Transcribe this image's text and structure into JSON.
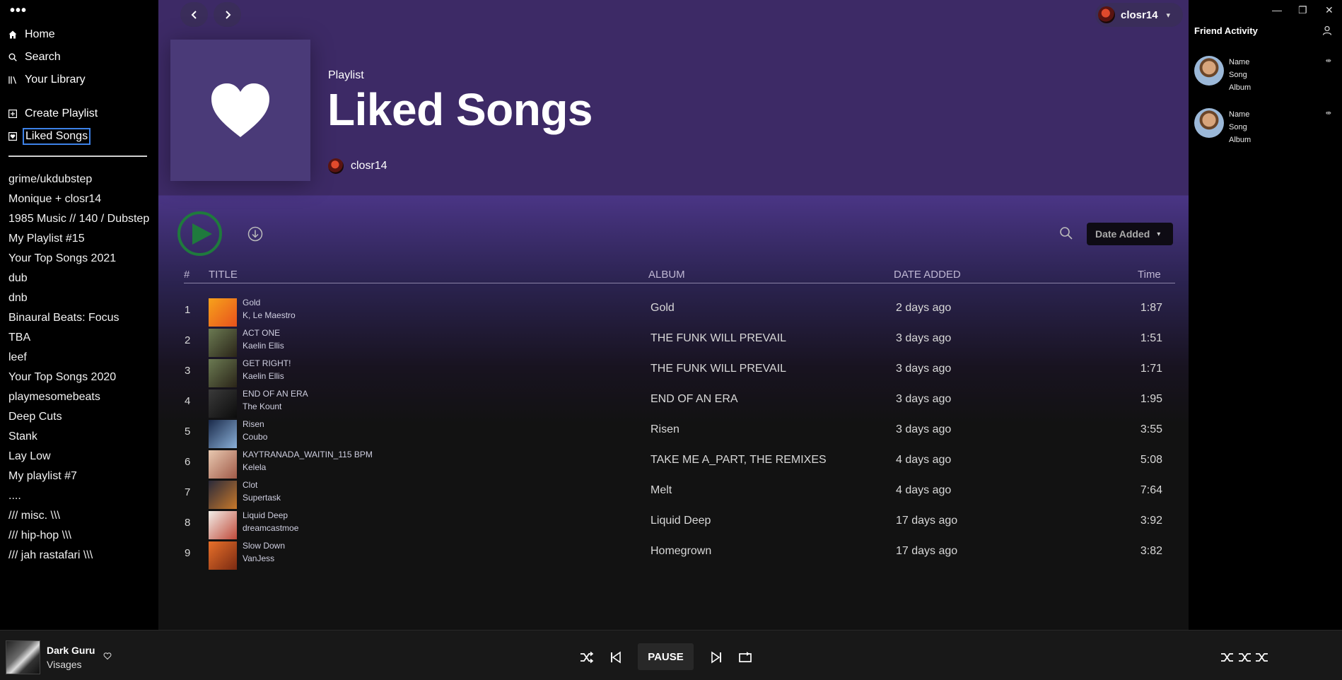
{
  "app": {
    "menu_label": "•••"
  },
  "sidebar": {
    "nav": [
      {
        "label": "Home",
        "icon": "home-icon"
      },
      {
        "label": "Search",
        "icon": "search-icon"
      },
      {
        "label": "Your Library",
        "icon": "library-icon"
      }
    ],
    "create_playlist": "Create Playlist",
    "liked_songs": "Liked Songs",
    "playlists": [
      "grime/ukdubstep",
      "Monique + closr14",
      "1985 Music // 140 / Dubstep",
      "My Playlist #15",
      "Your Top Songs 2021",
      "dub",
      "dnb",
      "Binaural Beats: Focus",
      "TBA",
      "leef",
      "Your Top Songs 2020",
      "playmesomebeats",
      "Deep Cuts",
      "Stank",
      "Lay Low",
      "My playlist #7",
      "....",
      "/// misc. \\\\\\",
      "/// hip-hop \\\\\\",
      "/// jah rastafari \\\\\\"
    ]
  },
  "header": {
    "username": "closr14",
    "accent": "#3d2a66"
  },
  "playlist": {
    "type": "Playlist",
    "title": "Liked Songs",
    "owner": "closr14"
  },
  "actions": {
    "sort_label": "Date Added"
  },
  "table": {
    "headers": {
      "num": "#",
      "title": "TITLE",
      "album": "ALBUM",
      "date": "DATE ADDED",
      "time": "Time"
    },
    "rows": [
      {
        "num": "1",
        "title": "Gold",
        "artist": "K, Le Maestro",
        "album": "Gold",
        "date": "2 days ago",
        "time": "1:87",
        "art": [
          "#f7a21b",
          "#e8521c"
        ]
      },
      {
        "num": "2",
        "title": "ACT ONE",
        "artist": "Kaelin Ellis",
        "album": "THE FUNK WILL PREVAIL",
        "date": "3 days ago",
        "time": "1:51",
        "art": [
          "#6b7a52",
          "#2a2418"
        ]
      },
      {
        "num": "3",
        "title": "GET RIGHT!",
        "artist": "Kaelin Ellis",
        "album": "THE FUNK WILL PREVAIL",
        "date": "3 days ago",
        "time": "1:71",
        "art": [
          "#6b7a52",
          "#2a2418"
        ]
      },
      {
        "num": "4",
        "title": "END OF AN ERA",
        "artist": "The Kount",
        "album": "END OF AN ERA",
        "date": "3 days ago",
        "time": "1:95",
        "art": [
          "#3a3a3a",
          "#0c0c0c"
        ]
      },
      {
        "num": "5",
        "title": "Risen",
        "artist": "Coubo",
        "album": "Risen",
        "date": "3 days ago",
        "time": "3:55",
        "art": [
          "#1a2a4a",
          "#8ab0d8"
        ]
      },
      {
        "num": "6",
        "title": "KAYTRANADA_WAITIN_115 BPM",
        "artist": "Kelela",
        "album": "TAKE ME A_PART, THE REMIXES",
        "date": "4 days ago",
        "time": "5:08",
        "art": [
          "#e8c8b0",
          "#a05a48"
        ]
      },
      {
        "num": "7",
        "title": "Clot",
        "artist": "Supertask",
        "album": "Melt",
        "date": "4 days ago",
        "time": "7:64",
        "art": [
          "#2a2a3a",
          "#c8782a"
        ]
      },
      {
        "num": "8",
        "title": "Liquid Deep",
        "artist": "dreamcastmoe",
        "album": "Liquid Deep",
        "date": "17 days ago",
        "time": "3:92",
        "art": [
          "#f2eee8",
          "#c04a3a"
        ]
      },
      {
        "num": "9",
        "title": "Slow Down",
        "artist": "VanJess",
        "album": "Homegrown",
        "date": "17 days ago",
        "time": "3:82",
        "art": [
          "#e8702a",
          "#7a2a12"
        ]
      }
    ]
  },
  "friends": {
    "title": "Friend Activity",
    "items": [
      {
        "name": "Name",
        "song": "Song",
        "album": "Album"
      },
      {
        "name": "Name",
        "song": "Song",
        "album": "Album"
      }
    ]
  },
  "player": {
    "track": "Dark Guru",
    "artist": "Visages",
    "pause_label": "PAUSE"
  }
}
